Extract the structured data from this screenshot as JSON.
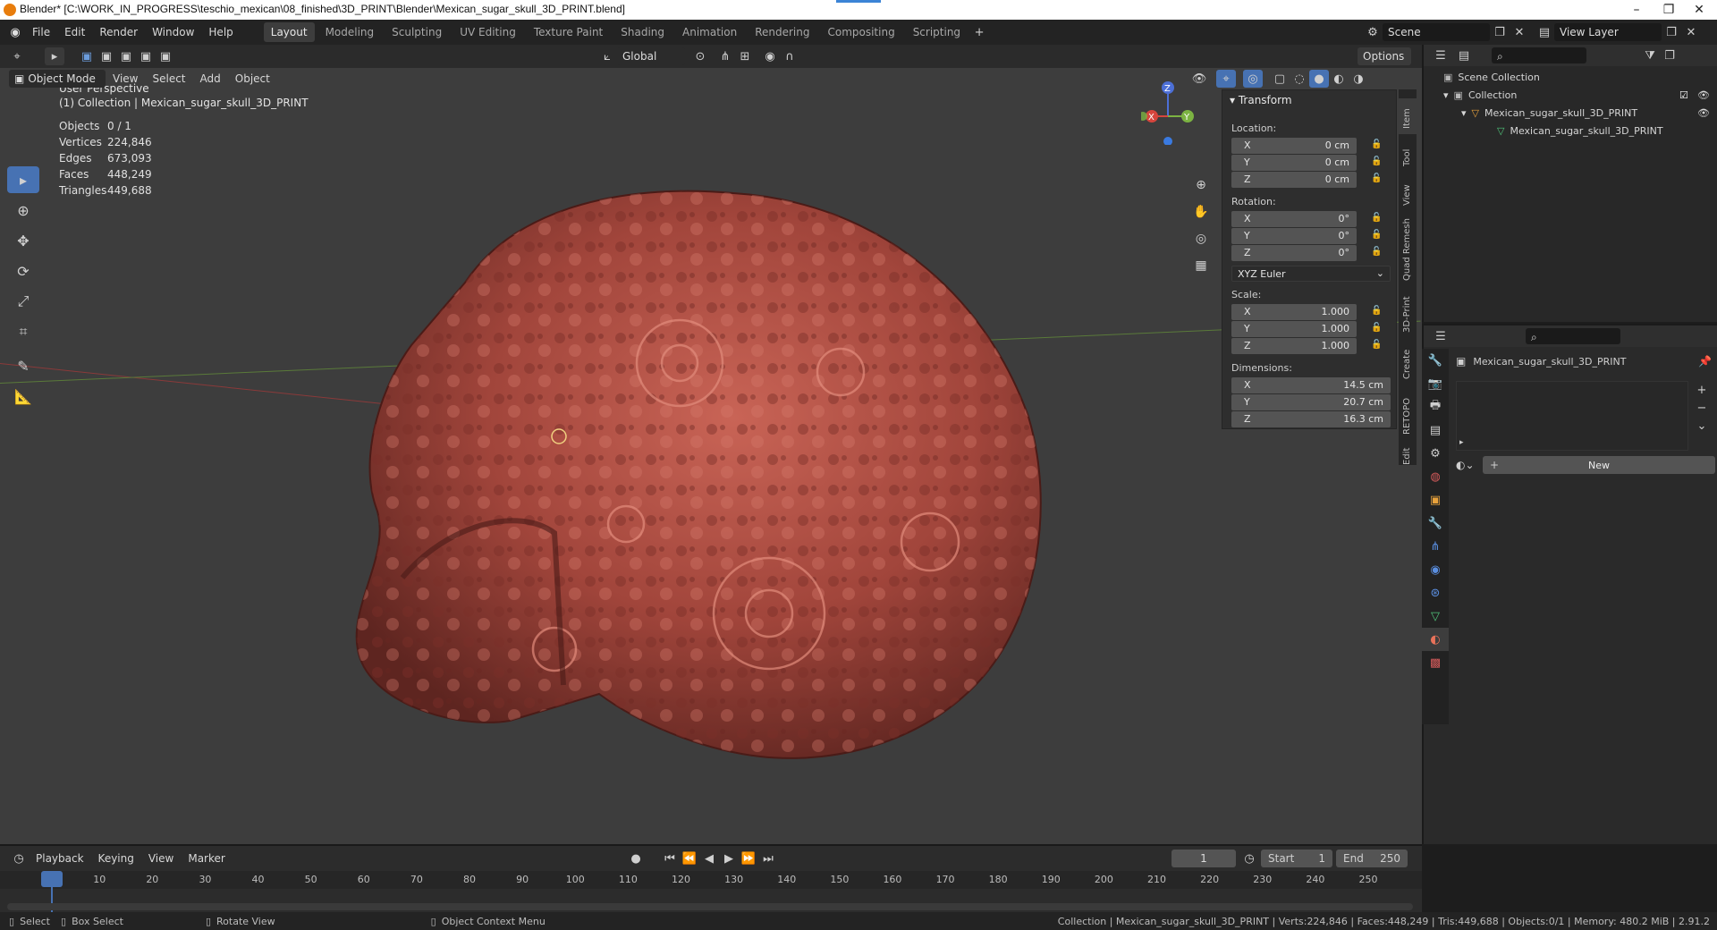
{
  "window": {
    "title": "Blender* [C:\\WORK_IN_PROGRESS\\teschio_mexican\\08_finished\\3D_PRINT\\Blender\\Mexican_sugar_skull_3D_PRINT.blend]",
    "controls": [
      "–",
      "❐",
      "✕"
    ]
  },
  "menu": [
    "File",
    "Edit",
    "Render",
    "Window",
    "Help"
  ],
  "workspaces": [
    {
      "label": "Layout",
      "active": true
    },
    {
      "label": "Modeling",
      "active": false
    },
    {
      "label": "Sculpting",
      "active": false
    },
    {
      "label": "UV Editing",
      "active": false
    },
    {
      "label": "Texture Paint",
      "active": false
    },
    {
      "label": "Shading",
      "active": false
    },
    {
      "label": "Animation",
      "active": false
    },
    {
      "label": "Rendering",
      "active": false
    },
    {
      "label": "Compositing",
      "active": false
    },
    {
      "label": "Scripting",
      "active": false
    }
  ],
  "scene": {
    "name": "Scene",
    "view_layer": "View Layer"
  },
  "tool_header": {
    "orientation": "Global",
    "options": "Options"
  },
  "viewport_header": {
    "mode": "Object Mode",
    "menus": [
      "View",
      "Select",
      "Add",
      "Object"
    ]
  },
  "overlay": {
    "perspective": "User Perspective",
    "collection": "(1) Collection | Mexican_sugar_skull_3D_PRINT",
    "stats": [
      {
        "label": "Objects",
        "value": "0 / 1"
      },
      {
        "label": "Vertices",
        "value": "224,846"
      },
      {
        "label": "Edges",
        "value": "673,093"
      },
      {
        "label": "Faces",
        "value": "448,249"
      },
      {
        "label": "Triangles",
        "value": "449,688"
      }
    ]
  },
  "gizmo": {
    "x": "X",
    "y": "Y",
    "z": "Z"
  },
  "transform": {
    "header": "Transform",
    "location_label": "Location:",
    "location": [
      {
        "axis": "X",
        "value": "0 cm"
      },
      {
        "axis": "Y",
        "value": "0 cm"
      },
      {
        "axis": "Z",
        "value": "0 cm"
      }
    ],
    "rotation_label": "Rotation:",
    "rotation": [
      {
        "axis": "X",
        "value": "0°"
      },
      {
        "axis": "Y",
        "value": "0°"
      },
      {
        "axis": "Z",
        "value": "0°"
      }
    ],
    "rotation_mode": "XYZ Euler",
    "scale_label": "Scale:",
    "scale": [
      {
        "axis": "X",
        "value": "1.000"
      },
      {
        "axis": "Y",
        "value": "1.000"
      },
      {
        "axis": "Z",
        "value": "1.000"
      }
    ],
    "dimensions_label": "Dimensions:",
    "dimensions": [
      {
        "axis": "X",
        "value": "14.5 cm"
      },
      {
        "axis": "Y",
        "value": "20.7 cm"
      },
      {
        "axis": "Z",
        "value": "16.3 cm"
      }
    ]
  },
  "side_tabs": [
    "Item",
    "Tool",
    "View",
    "Quad Remesh",
    "3D-Print",
    "Create",
    "RETOPO",
    "Edit"
  ],
  "outliner": {
    "rows": [
      {
        "label": "Scene Collection"
      },
      {
        "label": "Collection"
      },
      {
        "label": "Mexican_sugar_skull_3D_PRINT"
      },
      {
        "label": "Mexican_sugar_skull_3D_PRINT"
      }
    ]
  },
  "properties": {
    "object_name": "Mexican_sugar_skull_3D_PRINT",
    "new_button": "New"
  },
  "timeline": {
    "menus": [
      "Playback",
      "Keying",
      "View",
      "Marker"
    ],
    "current_frame": "1",
    "start_label": "Start",
    "start": "1",
    "end_label": "End",
    "end": "250",
    "ticks": [
      "1",
      "10",
      "20",
      "30",
      "40",
      "50",
      "60",
      "70",
      "80",
      "90",
      "100",
      "110",
      "120",
      "130",
      "140",
      "150",
      "160",
      "170",
      "180",
      "190",
      "200",
      "210",
      "220",
      "230",
      "240",
      "250"
    ]
  },
  "status": {
    "select": "Select",
    "box_select": "Box Select",
    "rotate_view": "Rotate View",
    "context_menu": "Object Context Menu",
    "info": "Collection | Mexican_sugar_skull_3D_PRINT | Verts:224,846 | Faces:448,249 | Tris:449,688 | Objects:0/1 | Memory: 480.2 MiB | 2.91.2"
  }
}
